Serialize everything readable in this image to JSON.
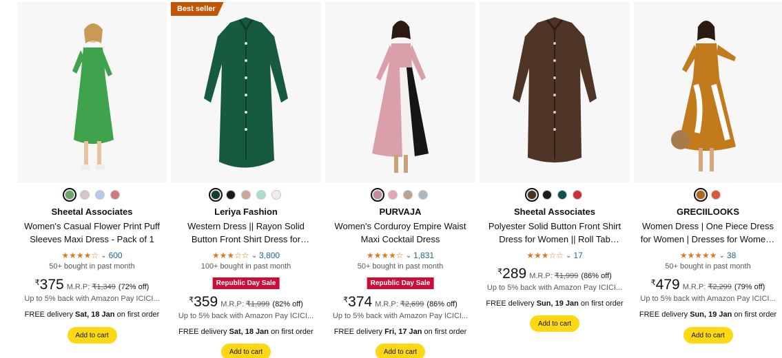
{
  "products": [
    {
      "best_seller": "",
      "brand": "Sheetal Associates",
      "title": "Women's Casual Flower Print Puff Sleeves Maxi Dress - Pack of 1",
      "stars": "★★★★☆",
      "rating_count": "600",
      "bought": "50+ bought in past month",
      "deal_badge": "",
      "currency": "₹",
      "price": "375",
      "mrp_label": "M.R.P:",
      "mrp": "₹1,349",
      "discount": "(72% off)",
      "cashback": "Up to 5% back with Amazon Pay ICICI...",
      "delivery_prefix": "FREE delivery",
      "delivery_date": "Sat, 18 Jan",
      "delivery_suffix": "on first order",
      "cart_label": "Add to cart",
      "swatches": [
        "#6aa56a",
        "#d8c5c5",
        "#b8c8ee",
        "#d07a7a"
      ],
      "dress_color": "#3fa34d"
    },
    {
      "best_seller": "Best seller",
      "brand": "Leriya Fashion",
      "title": "Western Dress || Rayon Solid Button Front Shirt Dress for Women || Ro...",
      "stars": "★★★☆☆",
      "rating_count": "3,800",
      "bought": "100+ bought in past month",
      "deal_badge": "Republic Day Sale",
      "currency": "₹",
      "price": "359",
      "mrp_label": "M.R.P:",
      "mrp": "₹1,999",
      "discount": "(82% off)",
      "cashback": "Up to 5% back with Amazon Pay ICICI...",
      "delivery_prefix": "FREE delivery",
      "delivery_date": "Sat, 18 Jan",
      "delivery_suffix": "on first order",
      "cart_label": "Add to cart",
      "swatches": [
        "#123d2e",
        "#1b1b1b",
        "#c9a89a",
        "#a9e0c8",
        "#f1ecec"
      ],
      "dress_color": "#175b3f"
    },
    {
      "best_seller": "",
      "brand": "PURVAJA",
      "title": "Women's Corduroy Empire Waist Maxi Cocktail Dress",
      "stars": "★★★★☆",
      "rating_count": "1,831",
      "bought": "50+ bought in past month",
      "deal_badge": "Republic Day Sale",
      "currency": "₹",
      "price": "374",
      "mrp_label": "M.R.P:",
      "mrp": "₹2,699",
      "discount": "(86% off)",
      "cashback": "Up to 5% back with Amazon Pay ICICI...",
      "delivery_prefix": "FREE delivery",
      "delivery_date": "Fri, 17 Jan",
      "delivery_suffix": "on first order",
      "cart_label": "Add to cart",
      "swatches": [
        "#c98a9a",
        "#e6a5b0",
        "#b9a58e",
        "#aab6c0"
      ],
      "dress_color": "#d9a0aa"
    },
    {
      "best_seller": "",
      "brand": "Sheetal Associates",
      "title": "Polyester Solid Button Front Shirt Dress for Women || Roll Tab Sleev...",
      "stars": "★★★☆☆",
      "rating_count": "17",
      "bought": "",
      "deal_badge": "",
      "currency": "₹",
      "price": "289",
      "mrp_label": "M.R.P:",
      "mrp": "₹1,999",
      "discount": "(86% off)",
      "cashback": "Up to 5% back with Amazon Pay ICICI...",
      "delivery_prefix": "FREE delivery",
      "delivery_date": "Sun, 19 Jan",
      "delivery_suffix": "on first order",
      "cart_label": "Add to cart",
      "swatches": [
        "#4a3323",
        "#1b1b1b",
        "#0f4f4f",
        "#c8303a"
      ],
      "dress_color": "#4e3526"
    },
    {
      "best_seller": "",
      "brand": "GRECIILOOKS",
      "title": "Women Dress | One Piece Dress for Women | Dresses for Women | Ma...",
      "stars": "★★★★★",
      "rating_count": "38",
      "bought": "50+ bought in past month",
      "deal_badge": "",
      "currency": "₹",
      "price": "479",
      "mrp_label": "M.R.P:",
      "mrp": "₹2,299",
      "discount": "(79% off)",
      "cashback": "Up to 5% back with Amazon Pay ICICI...",
      "delivery_prefix": "FREE delivery",
      "delivery_date": "Sun, 19 Jan",
      "delivery_suffix": "on first order",
      "cart_label": "Add to cart",
      "swatches": [
        "#b4651c",
        "#e0553a"
      ],
      "dress_color": "#c17b1c"
    }
  ]
}
